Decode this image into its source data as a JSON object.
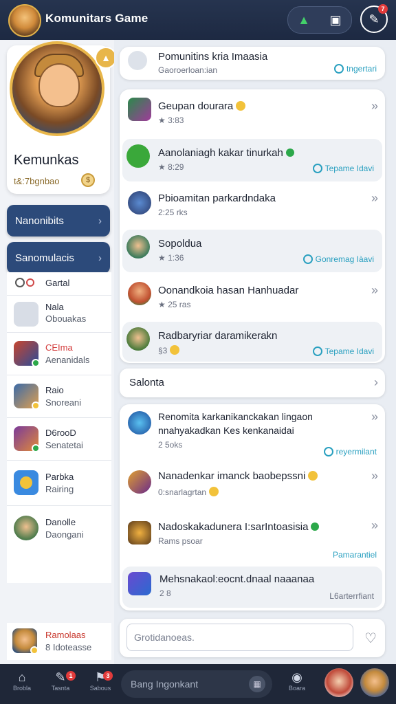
{
  "header": {
    "title": "Komunitars Game",
    "icons": [
      "game-logo",
      "trophy-icon",
      "dice-icon",
      "edit-icon"
    ],
    "notif_badge": "7"
  },
  "profile": {
    "name": "Kemunkas",
    "sub": "t&:7bgnbao",
    "coin": "$"
  },
  "nav": [
    {
      "label": "Nanonibits"
    },
    {
      "label": "Sanomulacis"
    }
  ],
  "side_items": [
    {
      "l1": "Gartal",
      "l2": ""
    },
    {
      "l1": "Nala",
      "l2": "Obouakas"
    },
    {
      "l1": "CEIma",
      "l2": "Aenanidals"
    },
    {
      "l1": "Raio",
      "l2": "Snoreani"
    },
    {
      "l1": "D6rooD",
      "l2": "Senatetai"
    },
    {
      "l1": "Parbka",
      "l2": "Rairing"
    },
    {
      "l1": "Danolle",
      "l2": "Daongani"
    }
  ],
  "bottom_user": {
    "l1": "Ramolaas",
    "l2": "8 Idoteasse"
  },
  "feed": {
    "top_card": {
      "title": "Pomunitins kria Imaasia",
      "meta": "Gaoroerloan:ian",
      "link": "tngertari"
    },
    "card1": [
      {
        "title": "Geupan dourara",
        "meta": "★ 3:83",
        "emoji": "yellow"
      },
      {
        "title": "Aanolaniagh kakar tinurkah",
        "meta": "★ 8:29",
        "link": "Tepame Idavi",
        "emoji": "green"
      },
      {
        "title": "Pbioamitan parkardndaka",
        "meta": "2:25 rks"
      },
      {
        "title": "Sopoldua",
        "meta": "★ 1:36",
        "link": "Gonremag Iàavi"
      },
      {
        "title": "Oonandkoia hasan Hanhuadar",
        "meta": "★ 25 ras"
      },
      {
        "title": "Radbaryriar daramikerakn",
        "meta": "§3",
        "link": "Tepame Idavi",
        "emoji": "yellow"
      }
    ],
    "section_label": "Salonta",
    "card2": [
      {
        "title": "Renomita karkanikanckakan lingaon",
        "title2": "nnahyakadkan Kes kenkanaidai",
        "meta": "2 5oks",
        "link": "reyermilant"
      },
      {
        "title": "Nanadenkar imanck baobepssni",
        "meta": "0:snarlagrtan",
        "emoji": "yellow"
      },
      {
        "title": "Nadoskakadunera I:sarIntoasisia",
        "meta": "Rams psoar",
        "link": "Pamarantiel",
        "emoji": "green"
      },
      {
        "title": "Mehsnakaol:eocnt.dnaal naaanaa",
        "meta": "2 8",
        "link": "L6arterrfiant"
      }
    ],
    "input_placeholder": "Grotidanoeas."
  },
  "bottombar": {
    "tabs": [
      {
        "icon": "⌂",
        "label": "Brobla"
      },
      {
        "icon": "✎",
        "label": "Tasnta"
      },
      {
        "icon": "⚑",
        "label": "Sabous"
      }
    ],
    "search_text": "Bang Ingonkant",
    "right_tab": {
      "icon": "◉",
      "label": "Boara"
    },
    "badges": [
      "1",
      "3"
    ]
  },
  "colors": {
    "header_bg": "#26344f",
    "nav_blue": "#2c4a7a",
    "accent_teal": "#2aa0c0",
    "green": "#2ca84a",
    "gold": "#e8b64a"
  }
}
